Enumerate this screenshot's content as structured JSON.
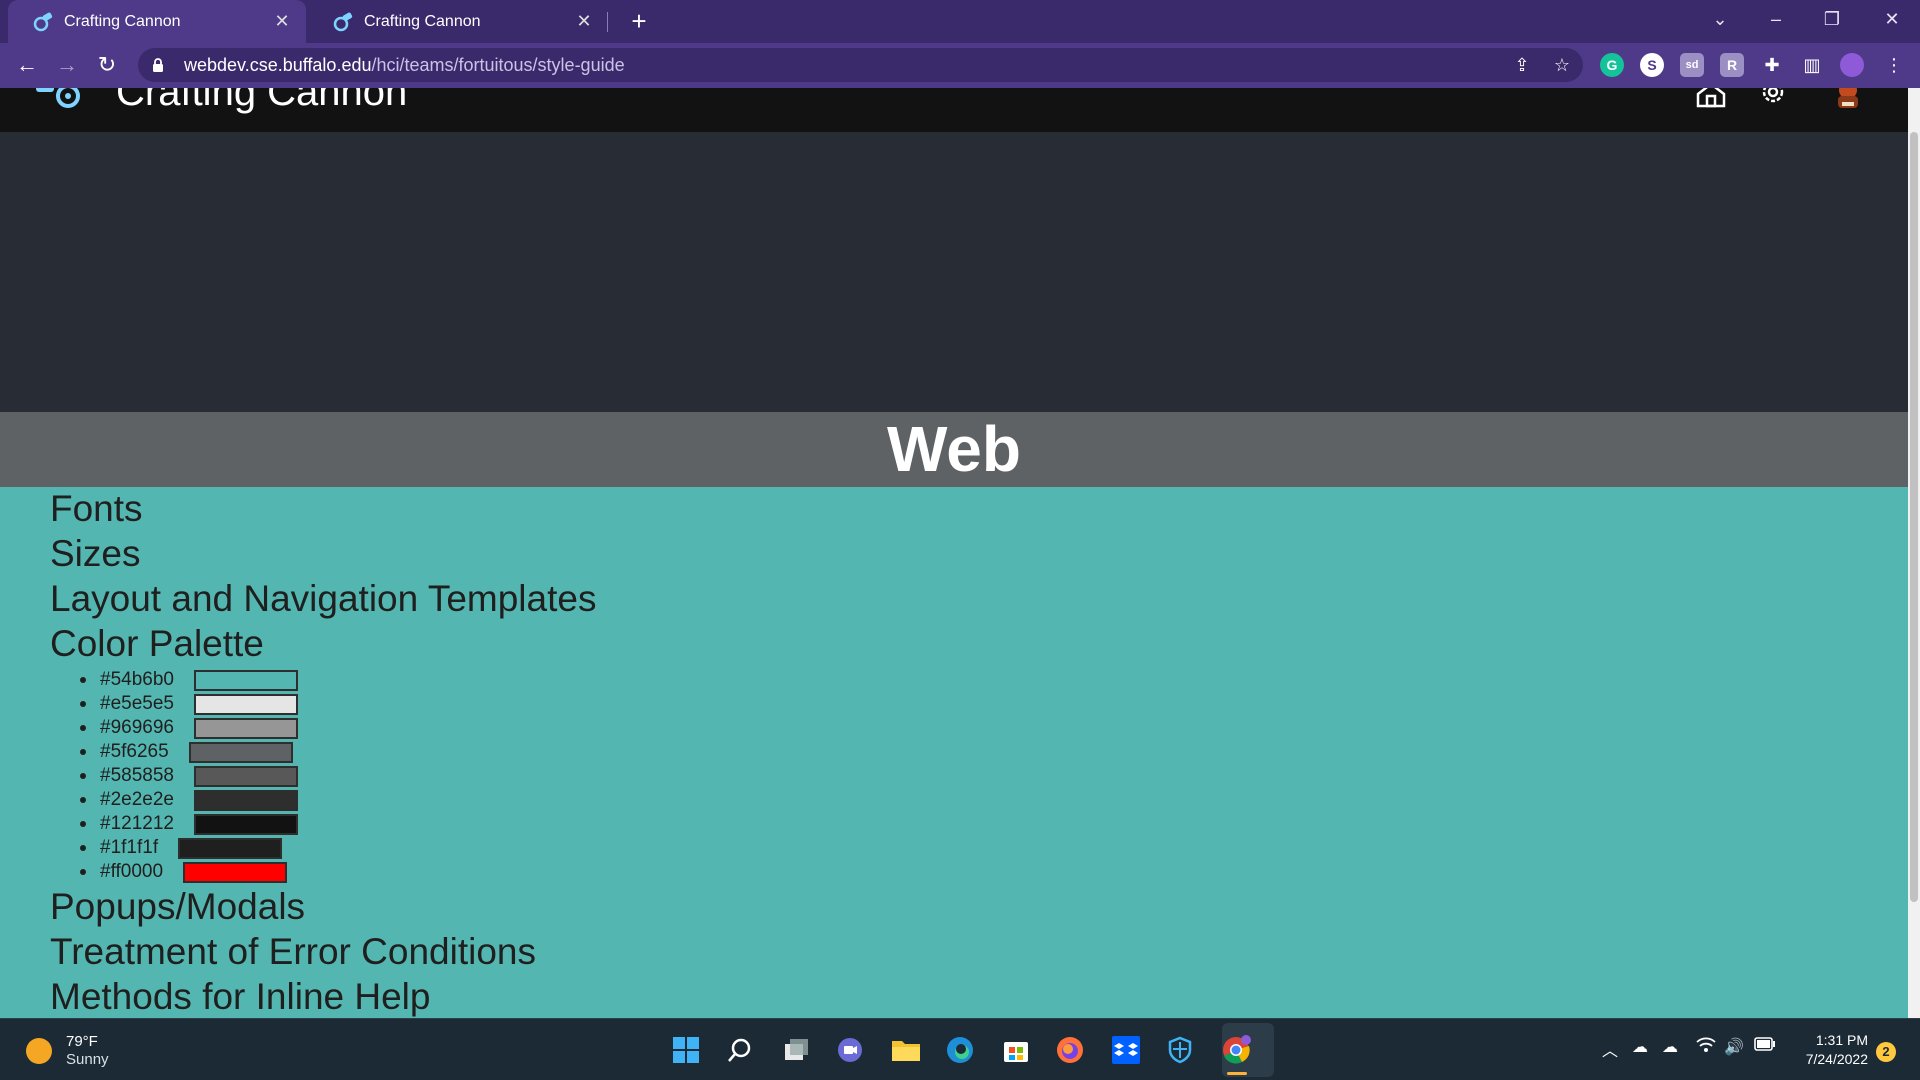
{
  "browser": {
    "tabs": [
      {
        "title": "Crafting Cannon",
        "active": true
      },
      {
        "title": "Crafting Cannon",
        "active": false
      }
    ],
    "new_tab_label": "+",
    "url_host": "webdev.cse.buffalo.edu",
    "url_path": "/hci/teams/fortuitous/style-guide",
    "window_controls": {
      "minimize": "–",
      "restore": "❐",
      "close": "✕",
      "tab_list": "⌄"
    },
    "extensions": [
      {
        "name": "grammarly-icon",
        "glyph": "G",
        "color": "#15c39a"
      },
      {
        "name": "s-extension-icon",
        "glyph": "S",
        "color": "#ffffff"
      },
      {
        "name": "sd-extension-icon",
        "glyph": "sd",
        "color": "#9b8fc4"
      },
      {
        "name": "r-extension-icon",
        "glyph": "R",
        "color": "#9b8fc4"
      }
    ]
  },
  "site": {
    "title": "Crafting Cannon",
    "band_title": "Web",
    "sections_top": [
      "Fonts",
      "Sizes",
      "Layout and Navigation Templates",
      "Color Palette"
    ],
    "palette": [
      {
        "code": "#54b6b0",
        "color": "#54b6b0"
      },
      {
        "code": "#e5e5e5",
        "color": "#e5e5e5"
      },
      {
        "code": "#969696",
        "color": "#969696"
      },
      {
        "code": "#5f6265",
        "color": "#5f6265"
      },
      {
        "code": "#585858",
        "color": "#585858"
      },
      {
        "code": "#2e2e2e",
        "color": "#2e2e2e"
      },
      {
        "code": "#121212",
        "color": "#121212"
      },
      {
        "code": "#1f1f1f",
        "color": "#1f1f1f"
      },
      {
        "code": "#ff0000",
        "color": "#ff0000"
      }
    ],
    "sections_bottom": [
      "Popups/Modals",
      "Treatment of Error Conditions",
      "Methods for Inline Help"
    ]
  },
  "taskbar": {
    "weather_temp": "79°F",
    "weather_desc": "Sunny",
    "time": "1:31 PM",
    "date": "7/24/2022",
    "notification_count": "2"
  }
}
